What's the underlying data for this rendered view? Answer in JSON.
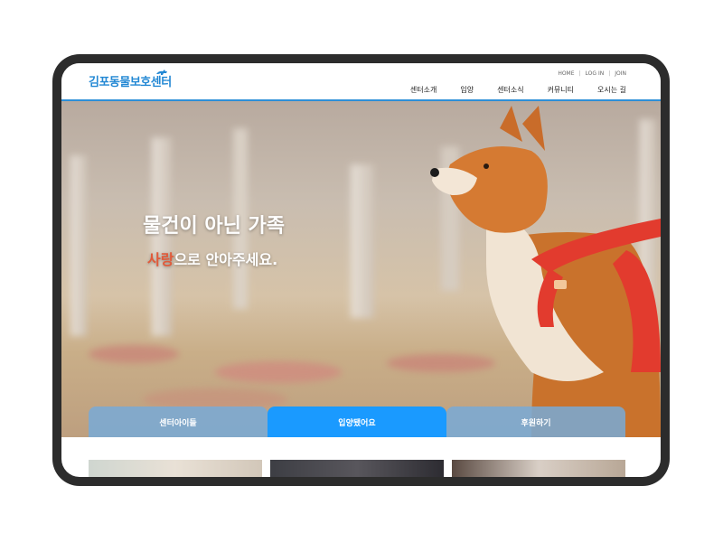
{
  "site": {
    "logo_text": "김포동물보호센터"
  },
  "top_links": [
    "HOME",
    "LOG IN",
    "JOIN"
  ],
  "nav": [
    "센터소개",
    "입양",
    "센터소식",
    "커뮤니티",
    "오시는 길"
  ],
  "hero": {
    "title": "물건이 아닌 가족",
    "sub_accent": "사랑",
    "sub_rest": "으로 안아주세요."
  },
  "tabs": [
    {
      "label": "센터아이들",
      "active": false
    },
    {
      "label": "입양됐어요",
      "active": true
    },
    {
      "label": "후원하기",
      "active": false
    }
  ],
  "colors": {
    "brand": "#2388d4",
    "active_tab": "#1a9aff",
    "accent_text": "#e15a3a",
    "device_frame": "#2c2c2c"
  }
}
